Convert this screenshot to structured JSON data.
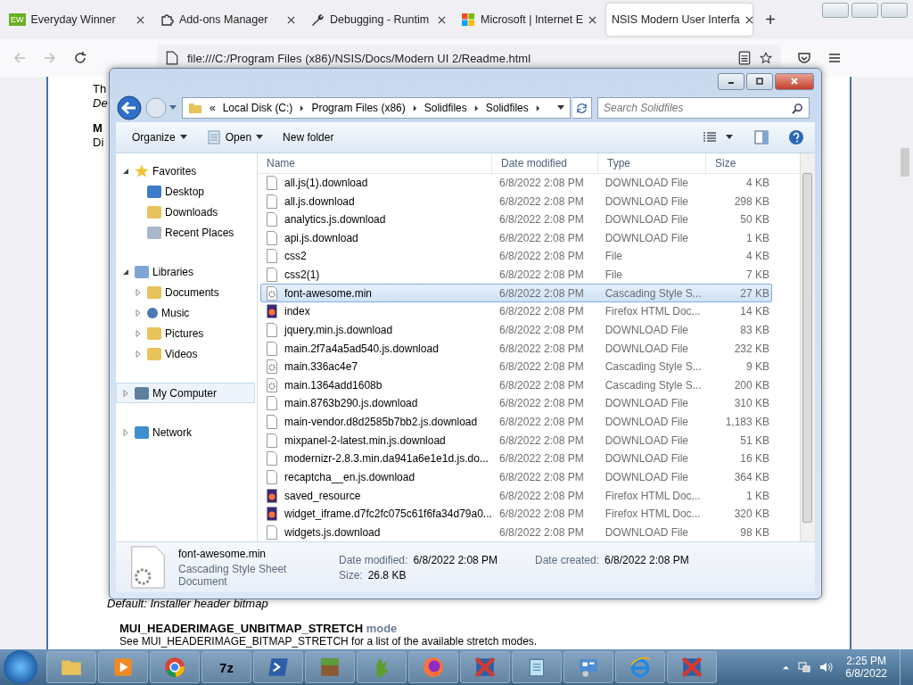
{
  "browser": {
    "tabs": [
      {
        "title": "Everyday Winner",
        "kind": "badge",
        "badge": "EW",
        "selected": false
      },
      {
        "title": "Add-ons Manager",
        "kind": "puzzle",
        "selected": false
      },
      {
        "title": "Debugging - Runtim",
        "kind": "wrench",
        "selected": false
      },
      {
        "title": "Microsoft | Internet E",
        "kind": "squares",
        "selected": false
      },
      {
        "title": "NSIS Modern User Interfa",
        "kind": "plain",
        "selected": true
      }
    ],
    "new_tab": "+",
    "address": "file:///C:/Program Files (x86)/NSIS/Docs/Modern UI 2/Readme.html"
  },
  "page": {
    "top_lines": [
      {
        "text": "Th",
        "kind": "plain"
      },
      {
        "text": "De",
        "kind": "italic"
      },
      {
        "text": "M",
        "kind": "bold"
      },
      {
        "text": "Di",
        "kind": "plain"
      }
    ],
    "default_line": "Default: Installer header bitmap",
    "heading": "MUI_HEADERIMAGE_UNBITMAP_STRETCH",
    "heading_param": "mode",
    "description": "See MUI_HEADERIMAGE_BITMAP_STRETCH for a list of the available stretch modes."
  },
  "explorer": {
    "breadcrumb_prefix": "«",
    "breadcrumb": [
      "Local Disk (C:)",
      "Program Files (x86)",
      "Solidfiles",
      "Solidfiles"
    ],
    "search": {
      "placeholder": "Search Solidfiles"
    },
    "toolbar": [
      "Organize",
      "Open",
      "New folder"
    ],
    "nav": [
      {
        "label": "Favorites",
        "kind": "star",
        "expanded": true,
        "selected": false,
        "children": [
          {
            "label": "Desktop",
            "kind": "desktop",
            "selected": false
          },
          {
            "label": "Downloads",
            "kind": "folder",
            "selected": false
          },
          {
            "label": "Recent Places",
            "kind": "recent",
            "selected": false
          }
        ]
      },
      {
        "label": "Libraries",
        "kind": "library",
        "expanded": true,
        "selected": false,
        "children": [
          {
            "label": "Documents",
            "kind": "folder",
            "expanded": false,
            "selected": false
          },
          {
            "label": "Music",
            "kind": "music",
            "expanded": false,
            "selected": false
          },
          {
            "label": "Pictures",
            "kind": "folder",
            "expanded": false,
            "selected": false
          },
          {
            "label": "Videos",
            "kind": "folder",
            "expanded": false,
            "selected": false
          }
        ]
      },
      {
        "label": "My Computer",
        "kind": "computer",
        "expanded": false,
        "selected": true
      },
      {
        "label": "Network",
        "kind": "network",
        "expanded": false,
        "selected": false
      }
    ],
    "columns": [
      "Name",
      "Date modified",
      "Type",
      "Size"
    ],
    "files": [
      {
        "name": "all.js(1).download",
        "date": "6/8/2022 2:08 PM",
        "type": "DOWNLOAD File",
        "size": "4 KB",
        "kind": "file",
        "selected": false
      },
      {
        "name": "all.js.download",
        "date": "6/8/2022 2:08 PM",
        "type": "DOWNLOAD File",
        "size": "298 KB",
        "kind": "file",
        "selected": false
      },
      {
        "name": "analytics.js.download",
        "date": "6/8/2022 2:08 PM",
        "type": "DOWNLOAD File",
        "size": "50 KB",
        "kind": "file",
        "selected": false
      },
      {
        "name": "api.js.download",
        "date": "6/8/2022 2:08 PM",
        "type": "DOWNLOAD File",
        "size": "1 KB",
        "kind": "file",
        "selected": false
      },
      {
        "name": "css2",
        "date": "6/8/2022 2:08 PM",
        "type": "File",
        "size": "4 KB",
        "kind": "file",
        "selected": false
      },
      {
        "name": "css2(1)",
        "date": "6/8/2022 2:08 PM",
        "type": "File",
        "size": "7 KB",
        "kind": "file",
        "selected": false
      },
      {
        "name": "font-awesome.min",
        "date": "6/8/2022 2:08 PM",
        "type": "Cascading Style S...",
        "size": "27 KB",
        "kind": "css",
        "selected": true
      },
      {
        "name": "index",
        "date": "6/8/2022 2:08 PM",
        "type": "Firefox HTML Doc...",
        "size": "14 KB",
        "kind": "html",
        "selected": false
      },
      {
        "name": "jquery.min.js.download",
        "date": "6/8/2022 2:08 PM",
        "type": "DOWNLOAD File",
        "size": "83 KB",
        "kind": "file",
        "selected": false
      },
      {
        "name": "main.2f7a4a5ad540.js.download",
        "date": "6/8/2022 2:08 PM",
        "type": "DOWNLOAD File",
        "size": "232 KB",
        "kind": "file",
        "selected": false
      },
      {
        "name": "main.336ac4e7",
        "date": "6/8/2022 2:08 PM",
        "type": "Cascading Style S...",
        "size": "9 KB",
        "kind": "css",
        "selected": false
      },
      {
        "name": "main.1364add1608b",
        "date": "6/8/2022 2:08 PM",
        "type": "Cascading Style S...",
        "size": "200 KB",
        "kind": "css",
        "selected": false
      },
      {
        "name": "main.8763b290.js.download",
        "date": "6/8/2022 2:08 PM",
        "type": "DOWNLOAD File",
        "size": "310 KB",
        "kind": "file",
        "selected": false
      },
      {
        "name": "main-vendor.d8d2585b7bb2.js.download",
        "date": "6/8/2022 2:08 PM",
        "type": "DOWNLOAD File",
        "size": "1,183 KB",
        "kind": "file",
        "selected": false
      },
      {
        "name": "mixpanel-2-latest.min.js.download",
        "date": "6/8/2022 2:08 PM",
        "type": "DOWNLOAD File",
        "size": "51 KB",
        "kind": "file",
        "selected": false
      },
      {
        "name": "modernizr-2.8.3.min.da941a6e1e1d.js.do...",
        "date": "6/8/2022 2:08 PM",
        "type": "DOWNLOAD File",
        "size": "16 KB",
        "kind": "file",
        "selected": false
      },
      {
        "name": "recaptcha__en.js.download",
        "date": "6/8/2022 2:08 PM",
        "type": "DOWNLOAD File",
        "size": "364 KB",
        "kind": "file",
        "selected": false
      },
      {
        "name": "saved_resource",
        "date": "6/8/2022 2:08 PM",
        "type": "Firefox HTML Doc...",
        "size": "1 KB",
        "kind": "html",
        "selected": false
      },
      {
        "name": "widget_iframe.d7fc2fc075c61f6fa34d79a0...",
        "date": "6/8/2022 2:08 PM",
        "type": "Firefox HTML Doc...",
        "size": "320 KB",
        "kind": "html",
        "selected": false
      },
      {
        "name": "widgets.js.download",
        "date": "6/8/2022 2:08 PM",
        "type": "DOWNLOAD File",
        "size": "98 KB",
        "kind": "file",
        "selected": false
      }
    ],
    "details": {
      "name": "font-awesome.min",
      "type": "Cascading Style Sheet Document",
      "fields": [
        {
          "label": "Date modified:",
          "value": "6/8/2022 2:08 PM"
        },
        {
          "label": "Date created:",
          "value": "6/8/2022 2:08 PM"
        },
        {
          "label": "Size:",
          "value": "26.8 KB"
        }
      ]
    }
  },
  "taskbar": {
    "items": [
      {
        "kind": "folder"
      },
      {
        "kind": "player"
      },
      {
        "kind": "chrome"
      },
      {
        "kind": "label",
        "label": "7z"
      },
      {
        "kind": "terminal"
      },
      {
        "kind": "block"
      },
      {
        "kind": "plant"
      },
      {
        "kind": "fox"
      },
      {
        "kind": "nsis"
      },
      {
        "kind": "notepad"
      },
      {
        "kind": "panel"
      },
      {
        "kind": "ie"
      },
      {
        "kind": "nsis"
      }
    ],
    "time": "2:25 PM",
    "date": "6/8/2022"
  }
}
